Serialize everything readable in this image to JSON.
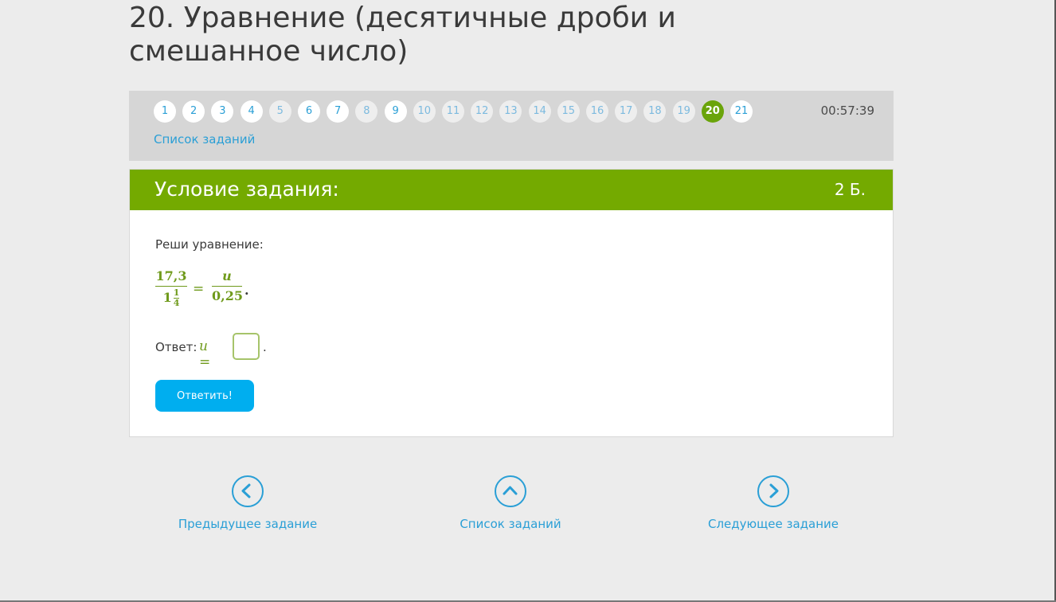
{
  "page_title": "20. Уравнение (десятичные дроби и смешанное число)",
  "nav": {
    "tasks": [
      {
        "label": "1",
        "state": "done"
      },
      {
        "label": "2",
        "state": "done"
      },
      {
        "label": "3",
        "state": "done"
      },
      {
        "label": "4",
        "state": "done"
      },
      {
        "label": "5",
        "state": "pending"
      },
      {
        "label": "6",
        "state": "done"
      },
      {
        "label": "7",
        "state": "done"
      },
      {
        "label": "8",
        "state": "pending"
      },
      {
        "label": "9",
        "state": "done"
      },
      {
        "label": "10",
        "state": "pending"
      },
      {
        "label": "11",
        "state": "pending"
      },
      {
        "label": "12",
        "state": "pending"
      },
      {
        "label": "13",
        "state": "pending"
      },
      {
        "label": "14",
        "state": "pending"
      },
      {
        "label": "15",
        "state": "pending"
      },
      {
        "label": "16",
        "state": "pending"
      },
      {
        "label": "17",
        "state": "pending"
      },
      {
        "label": "18",
        "state": "pending"
      },
      {
        "label": "19",
        "state": "pending"
      },
      {
        "label": "20",
        "state": "active"
      },
      {
        "label": "21",
        "state": "done"
      }
    ],
    "timer": "00:57:39",
    "task_list_link": "Список заданий"
  },
  "card": {
    "title": "Условие задания:",
    "points": "2 Б.",
    "instruction": "Реши уравнение:",
    "equation": {
      "left_num": "17,3",
      "left_den_whole": "1",
      "left_den_frac_num": "1",
      "left_den_frac_den": "4",
      "equals": "=",
      "right_num": "u",
      "right_den": "0,25",
      "end": "."
    },
    "answer_label": "Ответ:",
    "answer_var": "u =",
    "answer_value": "",
    "answer_end": ".",
    "submit_label": "Ответить!"
  },
  "bottom_nav": {
    "prev_label": "Предыдущее задание",
    "list_label": "Список заданий",
    "next_label": "Следующее задание"
  },
  "colors": {
    "accent_green": "#74aa00",
    "link_blue": "#2a9fd6",
    "button_blue": "#00aeef",
    "math_green": "#6f9a1b"
  }
}
